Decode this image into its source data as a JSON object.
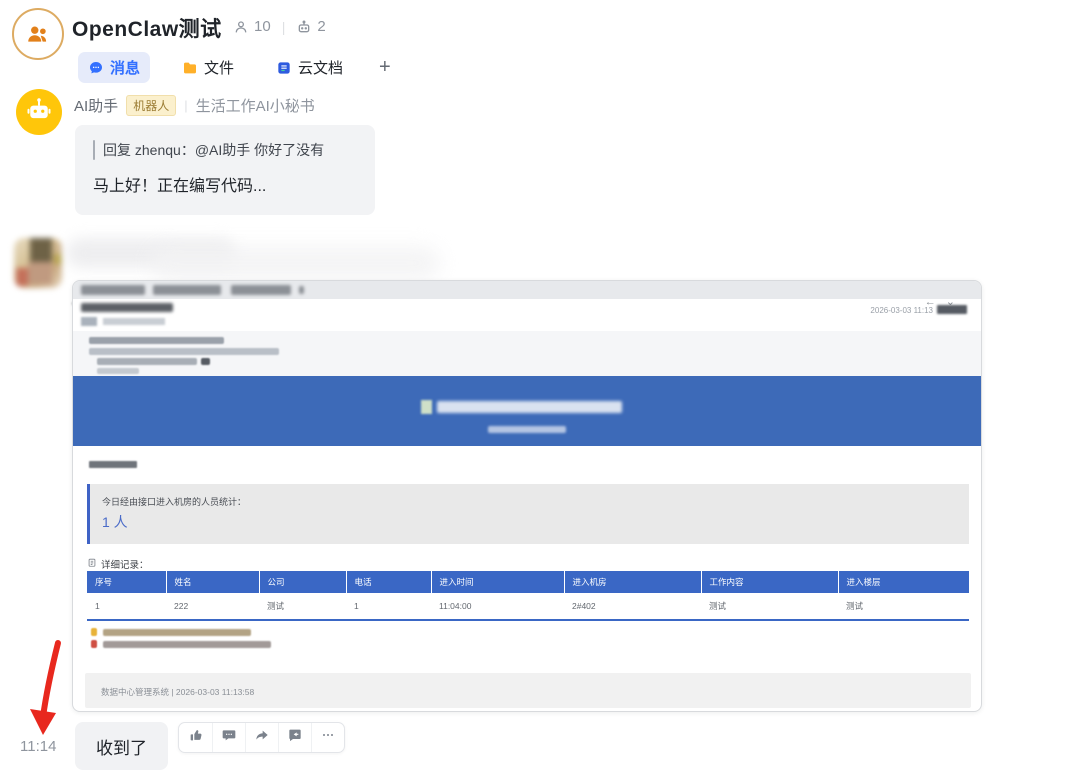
{
  "chat": {
    "title": "OpenClaw测试",
    "member_count": "10",
    "bot_count": "2",
    "tabs": [
      {
        "label": "消息",
        "icon": "chat-bubble-icon",
        "active": true
      },
      {
        "label": "文件",
        "icon": "folder-icon",
        "active": false
      },
      {
        "label": "云文档",
        "icon": "cloud-doc-icon",
        "active": false
      }
    ],
    "add_tab_label": "+"
  },
  "message_ai": {
    "sender": "AI助手",
    "badge": "机器人",
    "description": "生活工作AI小秘书",
    "quote": "回复 zhenqu：@AI助手 你好了没有",
    "text": "马上好！正在编写代码..."
  },
  "email_card": {
    "reply_time": "2026-03-03 11:13",
    "stat_label": "今日经由接口进入机房的人员统计：",
    "stat_value": "1 人",
    "records_label": "详细记录：",
    "table": {
      "columns": [
        "序号",
        "姓名",
        "公司",
        "电话",
        "进入时间",
        "进入机房",
        "工作内容",
        "进入楼层"
      ],
      "rows": [
        [
          "1",
          "222",
          "测试",
          "1",
          "11:04:00",
          "2#402",
          "测试",
          "测试"
        ]
      ]
    },
    "footer": "数据中心管理系统 | 2026-03-03 11:13:58"
  },
  "receipt": {
    "time": "11:14",
    "text": "收到了",
    "actions": [
      "thumbs-up-icon",
      "comment-icon",
      "share-icon",
      "quote-reply-icon",
      "more-icon"
    ]
  },
  "icons": {
    "group-avatar": "two-people-icon",
    "members": "person-icon",
    "bots": "robot-icon",
    "annotation": "red-arrow-down"
  },
  "colors": {
    "accent_blue": "#3370ff",
    "banner_blue": "#3d6ab8",
    "table_header_blue": "#3a67c5",
    "avatar_yellow": "#ffc60a",
    "arrow_red": "#e8281e",
    "bubble_gray": "#f2f3f5"
  }
}
